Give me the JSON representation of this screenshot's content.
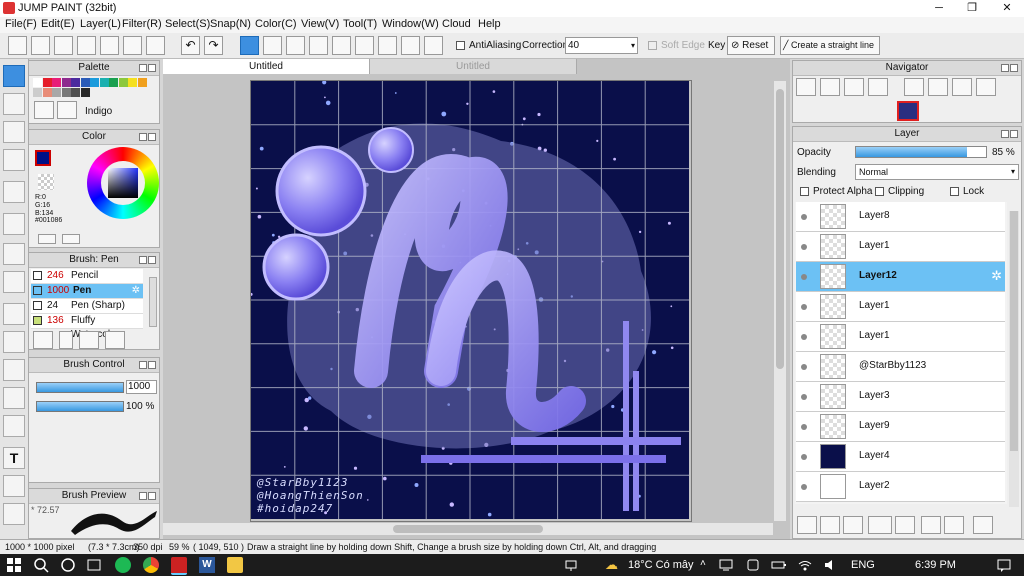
{
  "app": {
    "title": "JUMP PAINT (32bit)"
  },
  "menu": [
    "File(F)",
    "Edit(E)",
    "Layer(L)",
    "Filter(R)",
    "Select(S)",
    "Snap(N)",
    "Color(C)",
    "View(V)",
    "Tool(T)",
    "Window(W)",
    "Cloud",
    "Help"
  ],
  "toolbar": {
    "antialias_label": "AntiAliasing",
    "correction_label": "Correction",
    "correction_value": "40",
    "soft_edge_label": "Soft Edge",
    "key_label": "Key",
    "reset_label": "Reset",
    "straight_line_label": "Create a straight line"
  },
  "palette": {
    "title": "Palette",
    "name": "Indigo",
    "colors": [
      "#ffffff",
      "#e51d2a",
      "#e81d78",
      "#8e2a8e",
      "#4b2a9e",
      "#2a5bb8",
      "#1a9bdc",
      "#1ab0b0",
      "#1aa050",
      "#8cc83c",
      "#f5e01e",
      "#f0a01e",
      "#cccccc",
      "#e88c78",
      "#a8a8a8",
      "#787878",
      "#505050",
      "#282828"
    ]
  },
  "color": {
    "title": "Color",
    "primary": "#001086",
    "r": "R:0",
    "g": "G:16",
    "b": "B:134",
    "hex": "#001086"
  },
  "brush": {
    "title": "Brush: Pen",
    "items": [
      {
        "size": "246",
        "label": "Pencil",
        "color": "#222222"
      },
      {
        "size": "1000",
        "label": "Pen",
        "color": "#222222"
      },
      {
        "size": "24",
        "label": "Pen (Sharp)",
        "color": "#222222"
      },
      {
        "size": "136",
        "label": "Fluffy Watercolor",
        "color": "#c8e07a"
      }
    ]
  },
  "brush_control": {
    "title": "Brush Control",
    "size_value": "1000",
    "opacity_value": "100 %",
    "size_fill": 1.0,
    "opacity_fill": 1.0
  },
  "brush_preview": {
    "title": "Brush Preview",
    "value": "72.57"
  },
  "documents": {
    "active_tab": "Untitled",
    "inactive_tab": "Untitled"
  },
  "artwork": {
    "signature_lines": [
      "@StarBby1123",
      "@HoangThienSon",
      "#hoidap247"
    ],
    "bg": "#0a0f4a"
  },
  "navigator": {
    "title": "Navigator"
  },
  "layer_panel": {
    "title": "Layer",
    "opacity_label": "Opacity",
    "opacity_value": "85 %",
    "opacity_fill": 0.85,
    "blending_label": "Blending",
    "blending_value": "Normal",
    "protect_alpha_label": "Protect Alpha",
    "clipping_label": "Clipping",
    "lock_label": "Lock",
    "layers": [
      {
        "name": "Layer8",
        "selected": false
      },
      {
        "name": "Layer1",
        "selected": false
      },
      {
        "name": "Layer12",
        "selected": true
      },
      {
        "name": "Layer1",
        "selected": false
      },
      {
        "name": "Layer1",
        "selected": false
      },
      {
        "name": "@StarBby1123",
        "selected": false
      },
      {
        "name": "Layer3",
        "selected": false
      },
      {
        "name": "Layer9",
        "selected": false
      },
      {
        "name": "Layer4",
        "selected": false
      },
      {
        "name": "Layer2",
        "selected": false
      }
    ]
  },
  "status": {
    "size": "1000 * 1000 pixel",
    "cm": "(7.3 * 7.3cm)",
    "dpi": "350 dpi",
    "zoom": "59 %",
    "coords": "( 1049, 510 )",
    "hint": "Draw a straight line by holding down Shift, Change a brush size by holding down Ctrl, Alt, and dragging"
  },
  "taskbar": {
    "weather": "18°C  Có mây",
    "lang": "ENG",
    "time": "6:39 PM"
  }
}
